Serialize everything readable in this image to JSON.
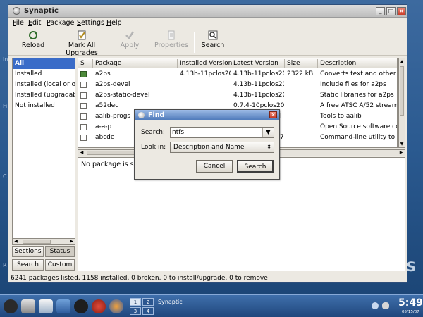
{
  "window": {
    "title": "Synaptic"
  },
  "menubar": [
    {
      "label": "File",
      "mnemonic": "F",
      "rest": "ile"
    },
    {
      "label": "Edit",
      "mnemonic": "E",
      "rest": "dit"
    },
    {
      "label": "Package",
      "mnemonic": "P",
      "rest": "ackage"
    },
    {
      "label": "Settings",
      "mnemonic": "S",
      "rest": "ettings"
    },
    {
      "label": "Help",
      "mnemonic": "H",
      "rest": "elp"
    }
  ],
  "toolbar": {
    "reload": "Reload",
    "mark_all": "Mark All Upgrades",
    "apply": "Apply",
    "properties": "Properties",
    "search": "Search"
  },
  "filters": [
    "All",
    "Installed",
    "Installed (local or ob",
    "Installed (upgradabl",
    "Not installed"
  ],
  "sidebar_buttons": {
    "sections": "Sections",
    "status": "Status",
    "search": "Search",
    "custom": "Custom"
  },
  "table": {
    "columns": [
      "S",
      "Package",
      "Installed Version",
      "Latest Version",
      "Size",
      "Description"
    ],
    "rows": [
      {
        "installed": true,
        "package": "a2ps",
        "installed_version": "4.13b-11pclos20",
        "latest_version": "4.13b-11pclos20",
        "size": "2322 kB",
        "description": "Converts text and other t"
      },
      {
        "installed": false,
        "package": "a2ps-devel",
        "installed_version": "",
        "latest_version": "4.13b-11pclos20",
        "size": "",
        "description": "Include files for a2ps"
      },
      {
        "installed": false,
        "package": "a2ps-static-devel",
        "installed_version": "",
        "latest_version": "4.13b-11pclos20",
        "size": "",
        "description": "Static libraries for a2ps"
      },
      {
        "installed": false,
        "package": "a52dec",
        "installed_version": "",
        "latest_version": "0.7.4-10pclos200",
        "size": "",
        "description": "A free ATSC A/52 stream"
      },
      {
        "installed": false,
        "package": "aalib-progs",
        "installed_version": "",
        "latest_version": "l",
        "size": "",
        "description": "Tools to aalib"
      },
      {
        "installed": false,
        "package": "a-a-p",
        "installed_version": "",
        "latest_version": "",
        "size": "",
        "description": "Open Source software co"
      },
      {
        "installed": false,
        "package": "abcde",
        "installed_version": "",
        "latest_version": "7",
        "size": "",
        "description": "Command-line utility to ri"
      }
    ]
  },
  "details": {
    "text": "No package is sele"
  },
  "statusbar": {
    "text": "6241 packages listed, 1158 installed, 0 broken. 0 to install/upgrade, 0 to remove"
  },
  "find_dialog": {
    "title": "Find",
    "search_label": "Search:",
    "search_value": "ntfs",
    "lookin_label": "Look in:",
    "lookin_value": "Description and Name",
    "cancel": "Cancel",
    "search_button": "Search"
  },
  "taskbar": {
    "pager": [
      "1",
      "2",
      "3",
      "4"
    ],
    "task": "Synaptic",
    "clock": "5:49",
    "date": "05/15/07"
  },
  "desktop": {
    "letters": [
      "In",
      "Fi",
      "C",
      "R"
    ],
    "brand": "S"
  },
  "colors": {
    "selection": "#3a6cc8",
    "titlebar_dialog": "#4b77b8",
    "taskbar": "#20477d"
  }
}
